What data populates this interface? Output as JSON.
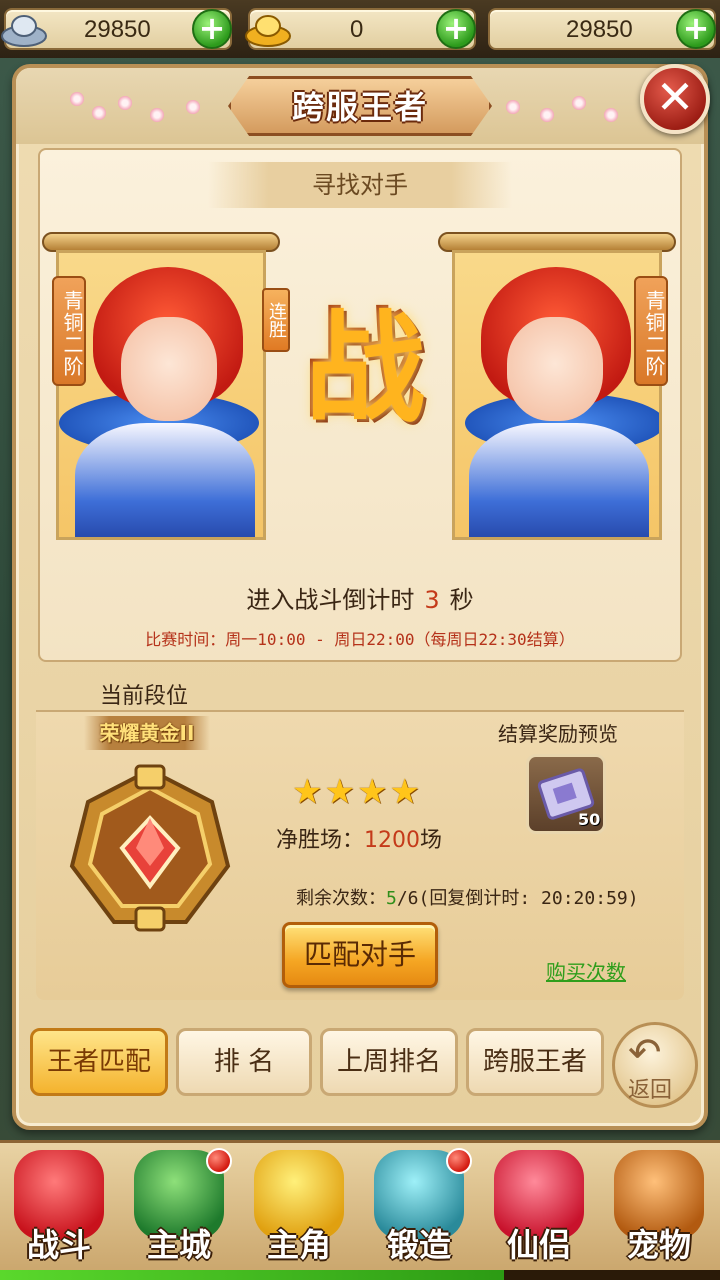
{
  "currency": [
    {
      "icon": "silver-ingot-icon",
      "value": "29850"
    },
    {
      "icon": "gold-ingot-icon",
      "value": "0"
    },
    {
      "icon": "none",
      "value": "29850"
    }
  ],
  "panel": {
    "title": "跨服王者",
    "find_opponent": "寻找对手",
    "left_rank": "青铜二阶",
    "right_rank": "青铜二阶",
    "streak": "连胜",
    "vs": "战",
    "countdown_prefix": "进入战斗倒计时",
    "countdown_value": "3",
    "countdown_suffix": "秒",
    "schedule": "比赛时间：周一10:00 - 周日22:00（每周日22:30结算）"
  },
  "rank": {
    "section_title": "当前段位",
    "tier": "荣耀黄金II",
    "stars": 4,
    "net_wins_label": "净胜场：",
    "net_wins_value": "1200",
    "net_wins_unit": "场",
    "reward_label": "结算奖励预览",
    "reward_count": "50",
    "remain_label": "剩余次数：",
    "remain_value": "5",
    "remain_total": "/6",
    "remain_timer": "(回复倒计时: 20:20:59)",
    "match_button": "匹配对手",
    "buy_link": "购买次数"
  },
  "tabs": [
    {
      "label": "王者匹配",
      "active": true
    },
    {
      "label": "排 名",
      "active": false
    },
    {
      "label": "上周排名",
      "active": false
    },
    {
      "label": "跨服王者",
      "active": false
    }
  ],
  "back_label": "返回",
  "nav": [
    {
      "label": "战斗",
      "badge": false,
      "color": "#e8323c"
    },
    {
      "label": "主城",
      "badge": true,
      "color": "#3aa64a"
    },
    {
      "label": "主角",
      "badge": false,
      "color": "#f5c21a"
    },
    {
      "label": "锻造",
      "badge": true,
      "color": "#4ab6c8"
    },
    {
      "label": "仙侣",
      "badge": false,
      "color": "#e8324a"
    },
    {
      "label": "宠物",
      "badge": false,
      "color": "#d97828"
    }
  ],
  "progress": 0.7
}
